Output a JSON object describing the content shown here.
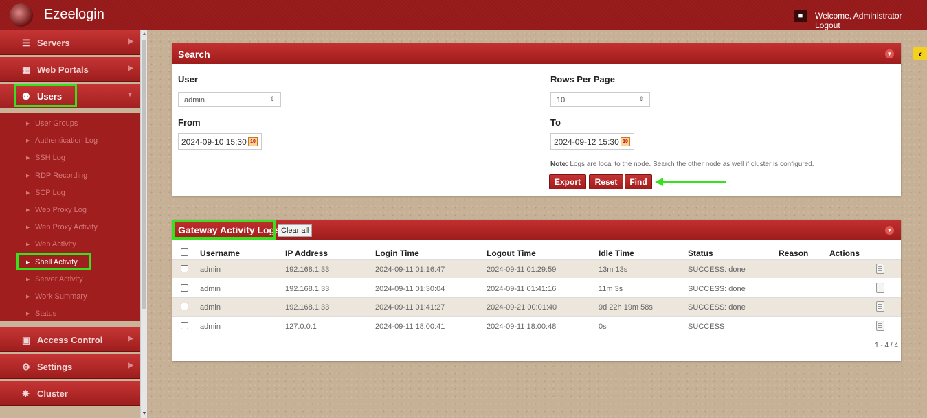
{
  "app": {
    "title": "Ezeelogin",
    "welcome": "Welcome, Administrator Logout"
  },
  "sidebar": {
    "main_items": [
      {
        "label": "Servers",
        "icon": "list-icon"
      },
      {
        "label": "Web Portals",
        "icon": "grid-icon"
      },
      {
        "label": "Users",
        "icon": "users-icon"
      },
      {
        "label": "Access Control",
        "icon": "lock-icon"
      },
      {
        "label": "Settings",
        "icon": "gears-icon"
      },
      {
        "label": "Cluster",
        "icon": "cluster-icon"
      }
    ],
    "sub_items": [
      "User Groups",
      "Authentication Log",
      "SSH Log",
      "RDP Recording",
      "SCP Log",
      "Web Proxy Log",
      "Web Proxy Activity",
      "Web Activity",
      "Shell Activity",
      "Server Activity",
      "Work Summary",
      "Status"
    ],
    "active_sub": "Shell Activity"
  },
  "search": {
    "title": "Search",
    "user_label": "User",
    "user_value": "admin",
    "rows_label": "Rows Per Page",
    "rows_value": "10",
    "from_label": "From",
    "from_value": "2024-09-10 15:30",
    "to_label": "To",
    "to_value": "2024-09-12 15:30",
    "note_bold": "Note:",
    "note_text": " Logs are local to the node. Search the other node as well if cluster is configured.",
    "export_label": "Export",
    "reset_label": "Reset",
    "find_label": "Find"
  },
  "logs": {
    "title": "Gateway Activity Logs",
    "clear_label": "Clear all",
    "columns": [
      "Username",
      "IP Address",
      "Login Time",
      "Logout Time",
      "Idle Time",
      "Status",
      "Reason",
      "Actions"
    ],
    "rows": [
      {
        "username": "admin",
        "ip": "192.168.1.33",
        "login": "2024-09-11 01:16:47",
        "logout": "2024-09-11 01:29:59",
        "idle": "13m 13s",
        "status": "SUCCESS: done",
        "reason": ""
      },
      {
        "username": "admin",
        "ip": "192.168.1.33",
        "login": "2024-09-11 01:30:04",
        "logout": "2024-09-11 01:41:16",
        "idle": "11m 3s",
        "status": "SUCCESS: done",
        "reason": ""
      },
      {
        "username": "admin",
        "ip": "192.168.1.33",
        "login": "2024-09-11 01:41:27",
        "logout": "2024-09-21 00:01:40",
        "idle": "9d 22h 19m 58s",
        "status": "SUCCESS: done",
        "reason": ""
      },
      {
        "username": "admin",
        "ip": "127.0.0.1",
        "login": "2024-09-11 18:00:41",
        "logout": "2024-09-11 18:00:48",
        "idle": "0s",
        "status": "SUCCESS",
        "reason": ""
      }
    ],
    "pagination": "1 - 4 / 4"
  },
  "colors": {
    "brand": "#9b1c1c",
    "highlight": "#39e01f",
    "tab": "#f4d11e"
  }
}
